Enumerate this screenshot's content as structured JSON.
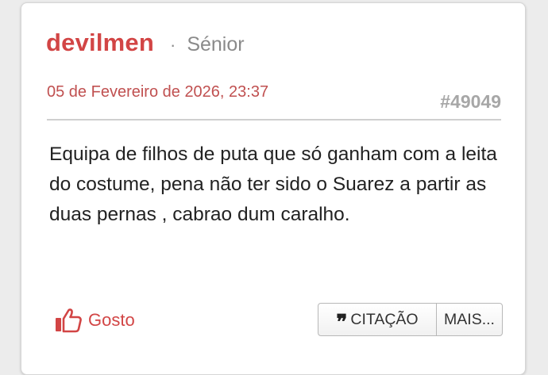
{
  "post": {
    "author": "devilmen",
    "separator": "·",
    "rank": "Sénior",
    "date": "05 de Fevereiro de 2026, 23:37",
    "number": "#49049",
    "body": "Equipa de filhos de puta que só ganham com a leita do costume, pena não ter sido o Suarez a partir as duas pernas , cabrao dum caralho."
  },
  "actions": {
    "like_label": "Gosto",
    "quote_label": "CITAÇÃO",
    "more_label": "MAIS...",
    "like_icon": "thumbs-up-icon",
    "quote_icon": "quote-icon"
  },
  "colors": {
    "accent": "#d24545",
    "muted": "#8a8a8a"
  }
}
